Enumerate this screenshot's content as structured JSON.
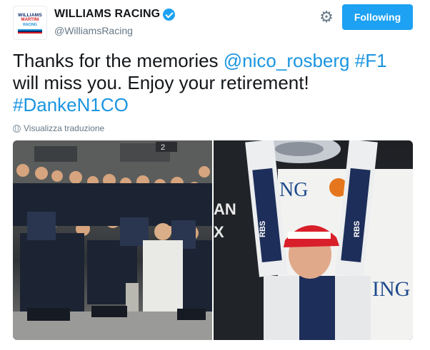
{
  "profile": {
    "avatar_lines": [
      "WILLIAMS",
      "MARTINI",
      "RACING"
    ],
    "name": "WILLIAMS RACING",
    "handle": "@WilliamsRacing",
    "verified": true
  },
  "actions": {
    "follow_label": "Following",
    "settings_icon": "gear-icon"
  },
  "tweet": {
    "part1": "Thanks for the memories ",
    "mention": "@nico_rosberg",
    "space1": " ",
    "hashtag1": "#F1",
    "part2": " will miss you. Enjoy your retirement! ",
    "hashtag2": "#DankeN1CO"
  },
  "translate": {
    "label": "Visualizza traduzione",
    "icon": "globe-icon"
  },
  "media": {
    "left_sign": "2",
    "right_texts": [
      "NG",
      "AN",
      "X",
      "RBS",
      "RBS",
      "ING"
    ]
  },
  "colors": {
    "accent": "#1da1f2",
    "link": "#1b95e0",
    "muted": "#657786"
  }
}
